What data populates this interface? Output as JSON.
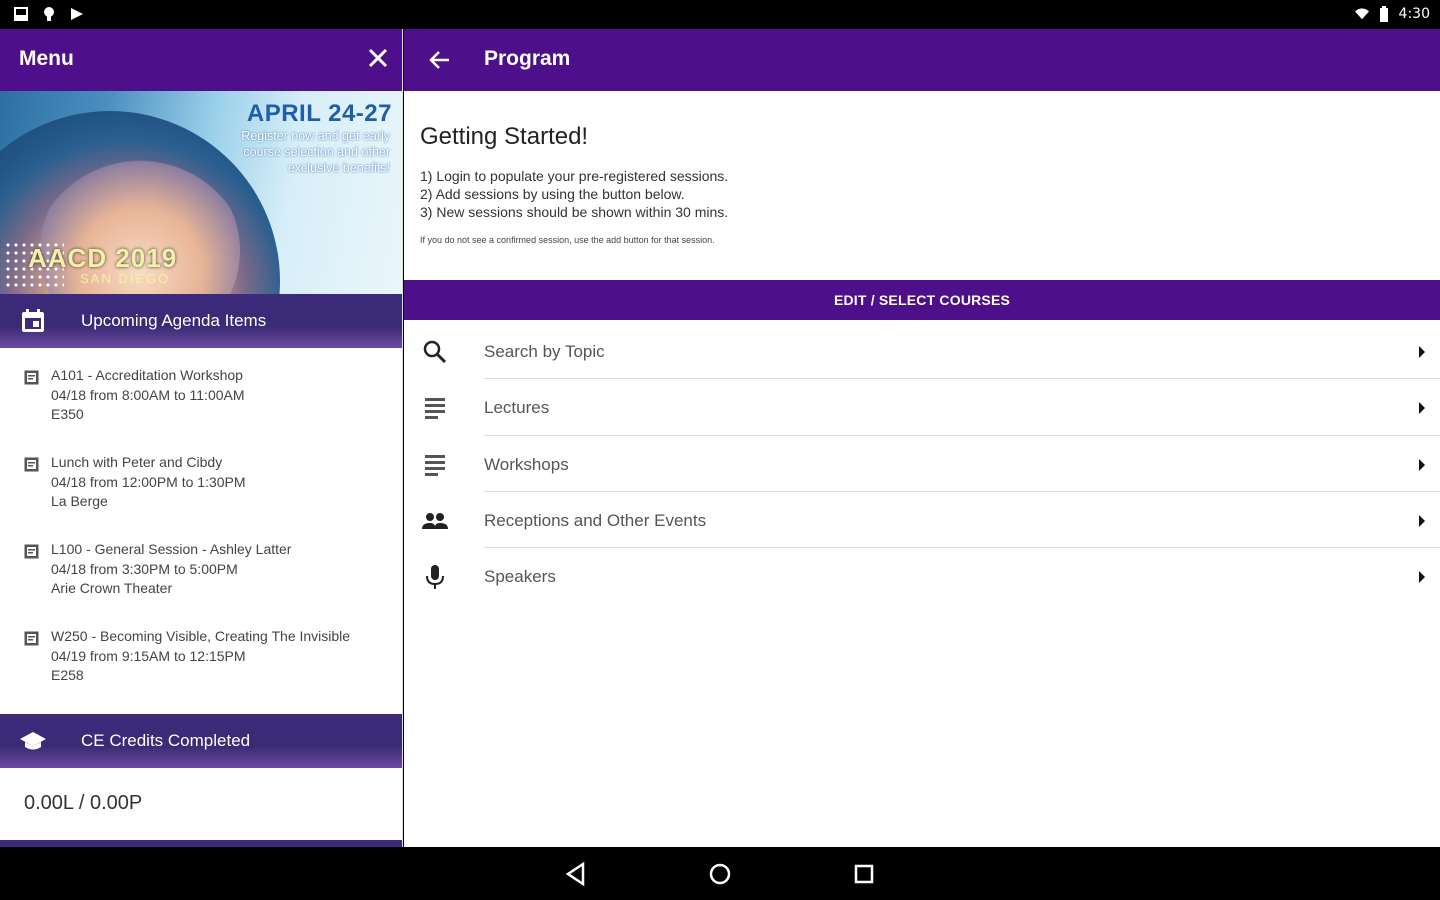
{
  "status_bar": {
    "time": "4:30",
    "left_icons": [
      "sim-card-icon",
      "notification-icon",
      "media-icon"
    ],
    "right_icons": [
      "wifi-icon",
      "battery-icon"
    ]
  },
  "drawer": {
    "title": "Menu",
    "banner": {
      "date": "APRIL 24-27",
      "blurb": "Register now and get early course selection and other exclusive benefits!",
      "conference": "AACD 2019",
      "city": "SAN DIEGO"
    },
    "upcoming": {
      "label": "Upcoming Agenda Items",
      "items": [
        {
          "title": "A101 - Accreditation Workshop",
          "time": "04/18 from 8:00AM to 11:00AM",
          "location": "E350"
        },
        {
          "title": "Lunch with Peter and Cibdy",
          "time": "04/18 from 12:00PM to 1:30PM",
          "location": "La Berge"
        },
        {
          "title": "L100 - General Session - Ashley Latter",
          "time": "04/18 from 3:30PM to 5:00PM",
          "location": "Arie Crown Theater"
        },
        {
          "title": "W250 - Becoming Visible, Creating The Invisible",
          "time": "04/19 from 9:15AM to 12:15PM",
          "location": "E258"
        }
      ]
    },
    "credits": {
      "label": "CE Credits Completed",
      "value": "0.00L / 0.00P"
    }
  },
  "main": {
    "title": "Program",
    "heading": "Getting Started!",
    "steps": [
      "1) Login to populate your pre-registered sessions.",
      "2) Add sessions by using the button below.",
      "3) New sessions should be shown within 30 mins."
    ],
    "note": "If you do not see a confirmed session, use the add button for that session.",
    "edit_button": "EDIT / SELECT COURSES",
    "menu": [
      {
        "label": "Search by Topic",
        "icon": "search-icon"
      },
      {
        "label": "Lectures",
        "icon": "list-icon"
      },
      {
        "label": "Workshops",
        "icon": "list-icon"
      },
      {
        "label": "Receptions and Other Events",
        "icon": "people-icon"
      },
      {
        "label": "Speakers",
        "icon": "microphone-icon"
      }
    ]
  },
  "colors": {
    "primary": "#4d0f8a",
    "section_bar": "#3d2a7c"
  }
}
